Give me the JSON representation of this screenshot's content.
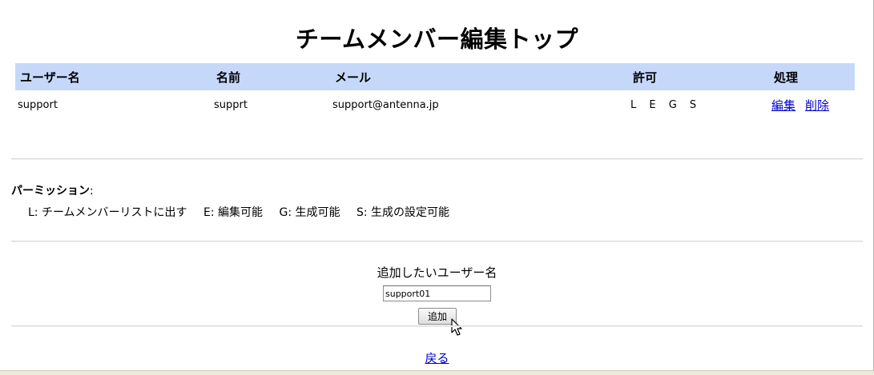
{
  "page": {
    "title": "チームメンバー編集トップ"
  },
  "table": {
    "headers": {
      "username": "ユーザー名",
      "name": "名前",
      "mail": "メール",
      "permission": "許可",
      "action": "処理"
    },
    "rows": [
      {
        "username": "support",
        "name": "supprt",
        "mail": "support@antenna.jp",
        "permission": "L E G S",
        "edit_label": "編集",
        "delete_label": "削除"
      }
    ]
  },
  "permissions": {
    "heading": "パーミッション",
    "colon": ":",
    "legend": [
      "L: チームメンバーリストに出す",
      "E: 編集可能",
      "G: 生成可能",
      "S: 生成の設定可能"
    ]
  },
  "add_member": {
    "label": "追加したいユーザー名",
    "input_value": "support01",
    "button_label": "追加"
  },
  "footer": {
    "back_label": "戻る"
  },
  "icons": {
    "cursor": "mouse-pointer-icon"
  }
}
